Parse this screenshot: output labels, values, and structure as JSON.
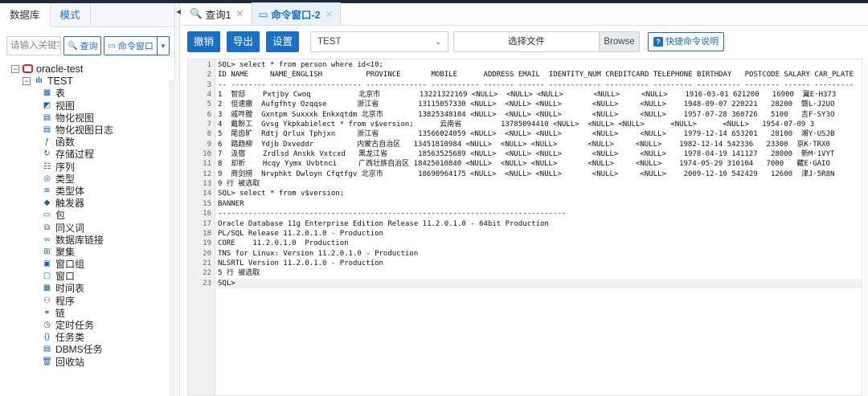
{
  "left": {
    "tabs": [
      "数据库",
      "模式"
    ],
    "search_placeholder": "请输入关键字",
    "query_btn": "查询",
    "cmd_btn": "命令窗口",
    "tree_root": "oracle-test",
    "tree_schema": "TEST",
    "tree_items": [
      {
        "icon": "table-icon",
        "glyph": "▦",
        "label": "表"
      },
      {
        "icon": "view-icon",
        "glyph": "◩",
        "label": "视图"
      },
      {
        "icon": "materialized-view-icon",
        "glyph": "▤",
        "label": "物化视图"
      },
      {
        "icon": "materialized-view-log-icon",
        "glyph": "▤",
        "label": "物化视图日志"
      },
      {
        "icon": "function-icon",
        "glyph": "ƒ",
        "label": "函数"
      },
      {
        "icon": "procedure-icon",
        "glyph": "↻",
        "label": "存储过程"
      },
      {
        "icon": "sequence-icon",
        "glyph": "☷",
        "label": "序列"
      },
      {
        "icon": "type-icon",
        "glyph": "◎",
        "label": "类型"
      },
      {
        "icon": "type-body-icon",
        "glyph": "≋",
        "label": "类型体"
      },
      {
        "icon": "trigger-icon",
        "glyph": "◆",
        "label": "触发器"
      },
      {
        "icon": "package-icon",
        "glyph": "▭",
        "label": "包"
      },
      {
        "icon": "synonym-icon",
        "glyph": "⧉",
        "label": "同义词"
      },
      {
        "icon": "dblink-icon",
        "glyph": "∞",
        "label": "数据库链接"
      },
      {
        "icon": "cluster-icon",
        "glyph": "⊞",
        "label": "聚集"
      },
      {
        "icon": "window-group-icon",
        "glyph": "▣",
        "label": "窗口组"
      },
      {
        "icon": "window-icon",
        "glyph": "▢",
        "label": "窗口"
      },
      {
        "icon": "schedule-icon",
        "glyph": "▦",
        "label": "时间表"
      },
      {
        "icon": "program-icon",
        "glyph": "⚇",
        "label": "程序"
      },
      {
        "icon": "chain-icon",
        "glyph": "⚭",
        "label": "链"
      },
      {
        "icon": "scheduled-task-icon",
        "glyph": "◷",
        "label": "定时任务"
      },
      {
        "icon": "task-class-icon",
        "glyph": "{}",
        "label": "任务类"
      },
      {
        "icon": "dbms-job-icon",
        "glyph": "▤",
        "label": "DBMS任务"
      },
      {
        "icon": "recycle-bin-icon",
        "glyph": "🗑",
        "label": "回收站"
      }
    ]
  },
  "tabs": [
    {
      "label": "查询1",
      "icon": "search-icon"
    },
    {
      "label": "命令窗口-2",
      "icon": "terminal-icon"
    }
  ],
  "toolbar": {
    "undo": "撤销",
    "export": "导出",
    "settings": "设置",
    "connection": "TEST",
    "file_label": "选择文件",
    "browse": "Browse",
    "help": "快捷命令说明"
  },
  "lines": [
    "SQL> select * from person where id<10;",
    "ID NAME     NAME_ENGLISH          PROVINCE       MOBILE      ADDRESS EMAIL  IDENTITY_NUM CREDITCARD TELEPHONE BIRTHDAY   POSTCODE SALARY CAR_PLATE",
    "-- -------- --------------------- -------------- ----------- ------- ------ ------------ ---------- --------- ---------- -------- ------ ---------",
    "1  智邸    Pxtjby Cwoq           北京市         13221322169 <NULL>  <NULL> <NULL>       <NULL>     <NULL>    1916-03-01 621200   16900  冀E·H373",
    "2  但速撤  Aufgfhty Ozqqse       浙江省         13115057330 <NULL>  <NULL> <NULL>       <NULL>     <NULL>    1948-09-07 220221   28200  赣L·J2UO",
    "3  戚吽膛  Gxntpm Suxxxk Enkxqtdm 北京市        13825348184 <NULL>  <NULL> <NULL>       <NULL>     <NULL>    1957-07-28 360726   5100   吉F·SY3O",
    "4  戴盼工  Gvsg Ykpkabielect * from v$version;      云南省         13785094410 <NULL>  <NULL> <NULL>      <NULL>      <NULL>   1954-07-09 3",
    "5  尾齿旷  Rdtj Qrlux Tphjxn     浙江省         13566024059 <NULL>  <NULL> <NULL>       <NULL>     <NULL>    1979-12-14 653201   28100  湘Y·USJB",
    "6  踏趋柳  Ydjb Dxveddr          内蒙古自治区   13451810984 <NULL>  <NULL> <NULL>       <NULL>     <NULL>    1982-12-14 542336   23300  京K·TRX0",
    "7  汲宿    Zrdlsd Anskk Vxtcxd   黑龙江省       18563525689 <NULL>  <NULL> <NULL>       <NULL>     <NULL>    1978-04-19 141127   28000  新M·1VYT",
    "8  却折    Hcqy Yymx Uvbtnci     广西壮族自治区 18425010840 <NULL>  <NULL> <NULL>       <NULL>     <NULL>    1974-05-29 310104   7000   藏E·GAIO",
    "9  商剑捞  Nrvphkt Dwloyn Cfqtfgv 北京市        18690964175 <NULL>  <NULL> <NULL>       <NULL>     <NULL>    2009-12-10 542429   12600  津J·5R8N",
    "9 行 被选取",
    "SQL> select * from v$version;",
    "BANNER",
    "--------------------------------------------------------------------------------",
    "Oracle Database 11g Enterprise Edition Release 11.2.0.1.0 - 64bit Production",
    "PL/SQL Release 11.2.0.1.0 - Production",
    "CORE    11.2.0.1.0  Production",
    "TNS for Linux: Version 11.2.0.1.0 - Production",
    "NLSRTL Version 11.2.0.1.0 - Production",
    "5 行 被选取",
    "SQL> "
  ]
}
